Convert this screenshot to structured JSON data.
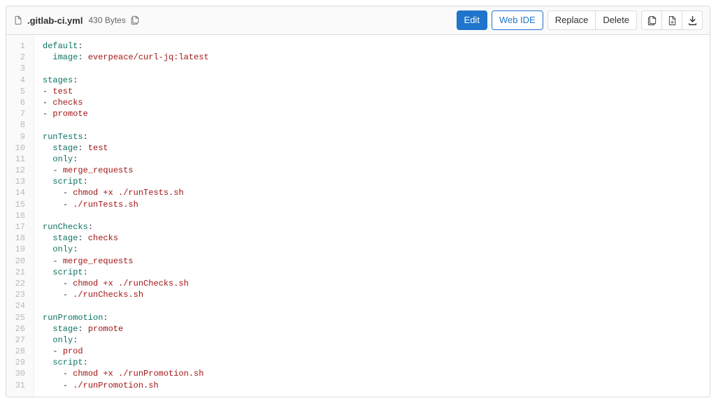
{
  "header": {
    "filename": ".gitlab-ci.yml",
    "filesize": "430 Bytes",
    "buttons": {
      "edit": "Edit",
      "webide": "Web IDE",
      "replace": "Replace",
      "delete": "Delete"
    }
  },
  "code": {
    "total_lines": 31,
    "lines": [
      [
        [
          "key",
          "default"
        ],
        [
          "punct",
          ":"
        ]
      ],
      [
        [
          "plain",
          "  "
        ],
        [
          "key",
          "image"
        ],
        [
          "punct",
          ": "
        ],
        [
          "str",
          "everpeace/curl-jq:latest"
        ]
      ],
      [],
      [
        [
          "key",
          "stages"
        ],
        [
          "punct",
          ":"
        ]
      ],
      [
        [
          "punct",
          "- "
        ],
        [
          "str",
          "test"
        ]
      ],
      [
        [
          "punct",
          "- "
        ],
        [
          "str",
          "checks"
        ]
      ],
      [
        [
          "punct",
          "- "
        ],
        [
          "str",
          "promote"
        ]
      ],
      [],
      [
        [
          "key",
          "runTests"
        ],
        [
          "punct",
          ":"
        ]
      ],
      [
        [
          "plain",
          "  "
        ],
        [
          "key",
          "stage"
        ],
        [
          "punct",
          ": "
        ],
        [
          "str",
          "test"
        ]
      ],
      [
        [
          "plain",
          "  "
        ],
        [
          "key",
          "only"
        ],
        [
          "punct",
          ":"
        ]
      ],
      [
        [
          "plain",
          "  "
        ],
        [
          "punct",
          "- "
        ],
        [
          "str",
          "merge_requests"
        ]
      ],
      [
        [
          "plain",
          "  "
        ],
        [
          "key",
          "script"
        ],
        [
          "punct",
          ":"
        ]
      ],
      [
        [
          "plain",
          "    "
        ],
        [
          "punct",
          "- "
        ],
        [
          "str",
          "chmod +x ./runTests.sh"
        ]
      ],
      [
        [
          "plain",
          "    "
        ],
        [
          "punct",
          "- "
        ],
        [
          "str",
          "./runTests.sh"
        ]
      ],
      [],
      [
        [
          "key",
          "runChecks"
        ],
        [
          "punct",
          ":"
        ]
      ],
      [
        [
          "plain",
          "  "
        ],
        [
          "key",
          "stage"
        ],
        [
          "punct",
          ": "
        ],
        [
          "str",
          "checks"
        ]
      ],
      [
        [
          "plain",
          "  "
        ],
        [
          "key",
          "only"
        ],
        [
          "punct",
          ":"
        ]
      ],
      [
        [
          "plain",
          "  "
        ],
        [
          "punct",
          "- "
        ],
        [
          "str",
          "merge_requests"
        ]
      ],
      [
        [
          "plain",
          "  "
        ],
        [
          "key",
          "script"
        ],
        [
          "punct",
          ":"
        ]
      ],
      [
        [
          "plain",
          "    "
        ],
        [
          "punct",
          "- "
        ],
        [
          "str",
          "chmod +x ./runChecks.sh"
        ]
      ],
      [
        [
          "plain",
          "    "
        ],
        [
          "punct",
          "- "
        ],
        [
          "str",
          "./runChecks.sh"
        ]
      ],
      [],
      [
        [
          "key",
          "runPromotion"
        ],
        [
          "punct",
          ":"
        ]
      ],
      [
        [
          "plain",
          "  "
        ],
        [
          "key",
          "stage"
        ],
        [
          "punct",
          ": "
        ],
        [
          "str",
          "promote"
        ]
      ],
      [
        [
          "plain",
          "  "
        ],
        [
          "key",
          "only"
        ],
        [
          "punct",
          ":"
        ]
      ],
      [
        [
          "plain",
          "  "
        ],
        [
          "punct",
          "- "
        ],
        [
          "str",
          "prod"
        ]
      ],
      [
        [
          "plain",
          "  "
        ],
        [
          "key",
          "script"
        ],
        [
          "punct",
          ":"
        ]
      ],
      [
        [
          "plain",
          "    "
        ],
        [
          "punct",
          "- "
        ],
        [
          "str",
          "chmod +x ./runPromotion.sh"
        ]
      ],
      [
        [
          "plain",
          "    "
        ],
        [
          "punct",
          "- "
        ],
        [
          "str",
          "./runPromotion.sh"
        ]
      ]
    ]
  }
}
